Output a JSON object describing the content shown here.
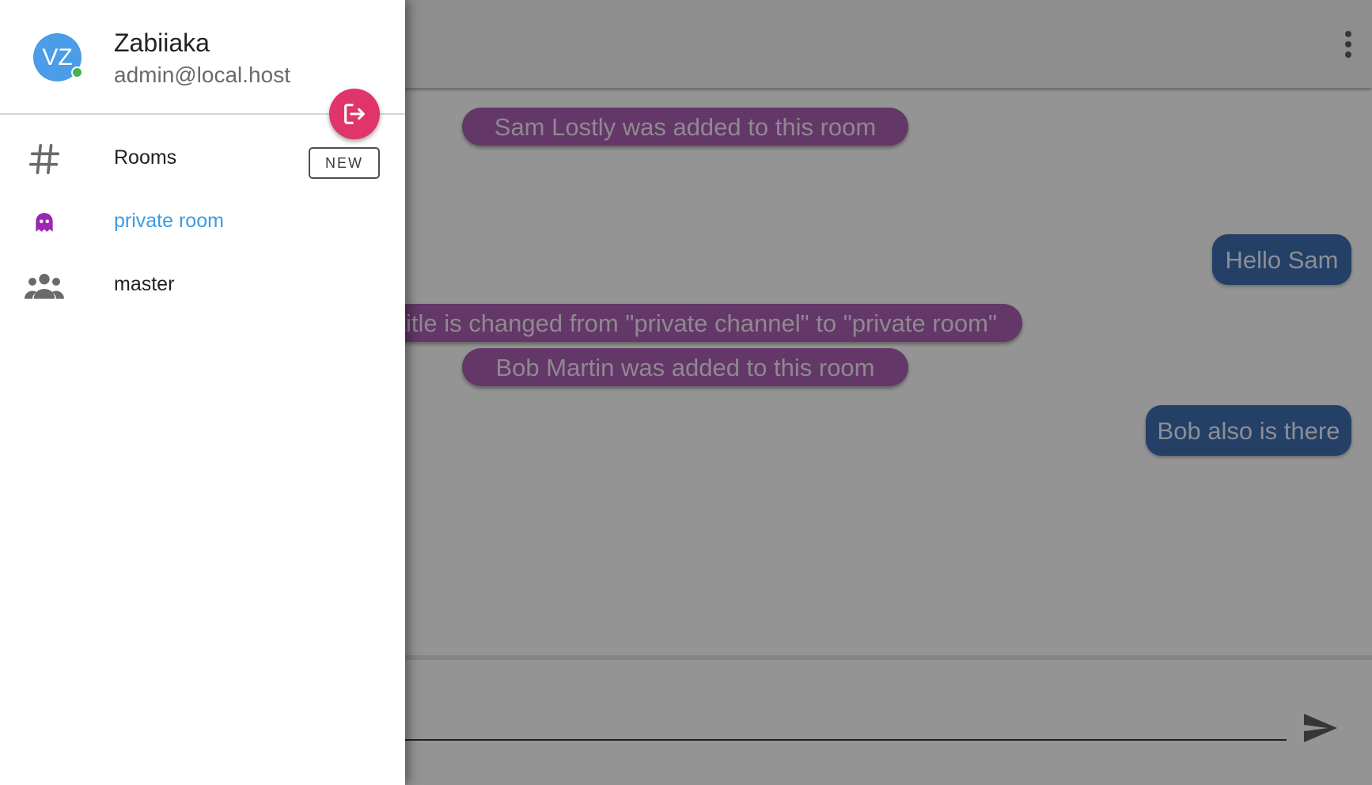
{
  "user": {
    "initials": "VZ",
    "name": "Zabiiaka",
    "email": "admin@local.host",
    "online": true
  },
  "sidebar": {
    "rooms_section": {
      "label": "Rooms",
      "icon": "hash-icon",
      "new_button_label": "NEW"
    },
    "items": [
      {
        "label": "private room",
        "icon": "ghost-icon",
        "selected": true
      },
      {
        "label": "master",
        "icon": "people-group-icon",
        "selected": false
      }
    ]
  },
  "chat": {
    "messages": [
      {
        "type": "system",
        "text": "Sam Lostly was added to this room"
      },
      {
        "type": "own",
        "text": "Hello Sam"
      },
      {
        "type": "system",
        "text": "Room title is changed from \"private channel\" to \"private room\""
      },
      {
        "type": "system",
        "text": "Bob Martin was added to this room"
      },
      {
        "type": "own",
        "text": "Bob also is there"
      }
    ],
    "composer_value": ""
  },
  "colors": {
    "avatar": "#4a9de6",
    "presence_online": "#4caf50",
    "logout_fab": "#e0356a",
    "selected_room_text": "#3a9be3",
    "ghost_icon": "#9c27b0",
    "system_message": "#ab5fb4",
    "own_message": "#3e6eb0",
    "overlay": "rgba(0,0,0,0.42)"
  }
}
